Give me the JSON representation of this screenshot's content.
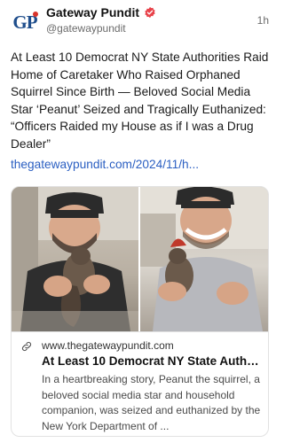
{
  "account": {
    "name": "Gateway Pundit",
    "handle": "@gatewaypundit",
    "avatar_text": "GP",
    "verified_icon": "verified-badge-icon",
    "time": "1h"
  },
  "post": {
    "text": "At Least 10 Democrat NY State Authorities Raid Home of Caretaker Who Raised Orphaned Squirrel Since Birth — Beloved Social Media Star ‘Peanut’ Seized and Tragically Euthanized: “Officers Raided my House as if I was a Drug Dealer”",
    "link": "thegatewaypundit.com/2024/11/h..."
  },
  "card": {
    "domain": "www.thegatewaypundit.com",
    "title": "At Least 10 Democrat NY State Autho...",
    "description": "In a heartbreaking story, Peanut the squirrel, a beloved social media star and household companion, was seized and euthanized by the New York Department of ...",
    "link_icon": "link-icon",
    "images": [
      "photo-man-holding-squirrel-left",
      "photo-man-holding-squirrel-right"
    ]
  },
  "colors": {
    "link": "#2b5fc2",
    "verified": "#e8424a",
    "logo": "#1f4e8c"
  }
}
